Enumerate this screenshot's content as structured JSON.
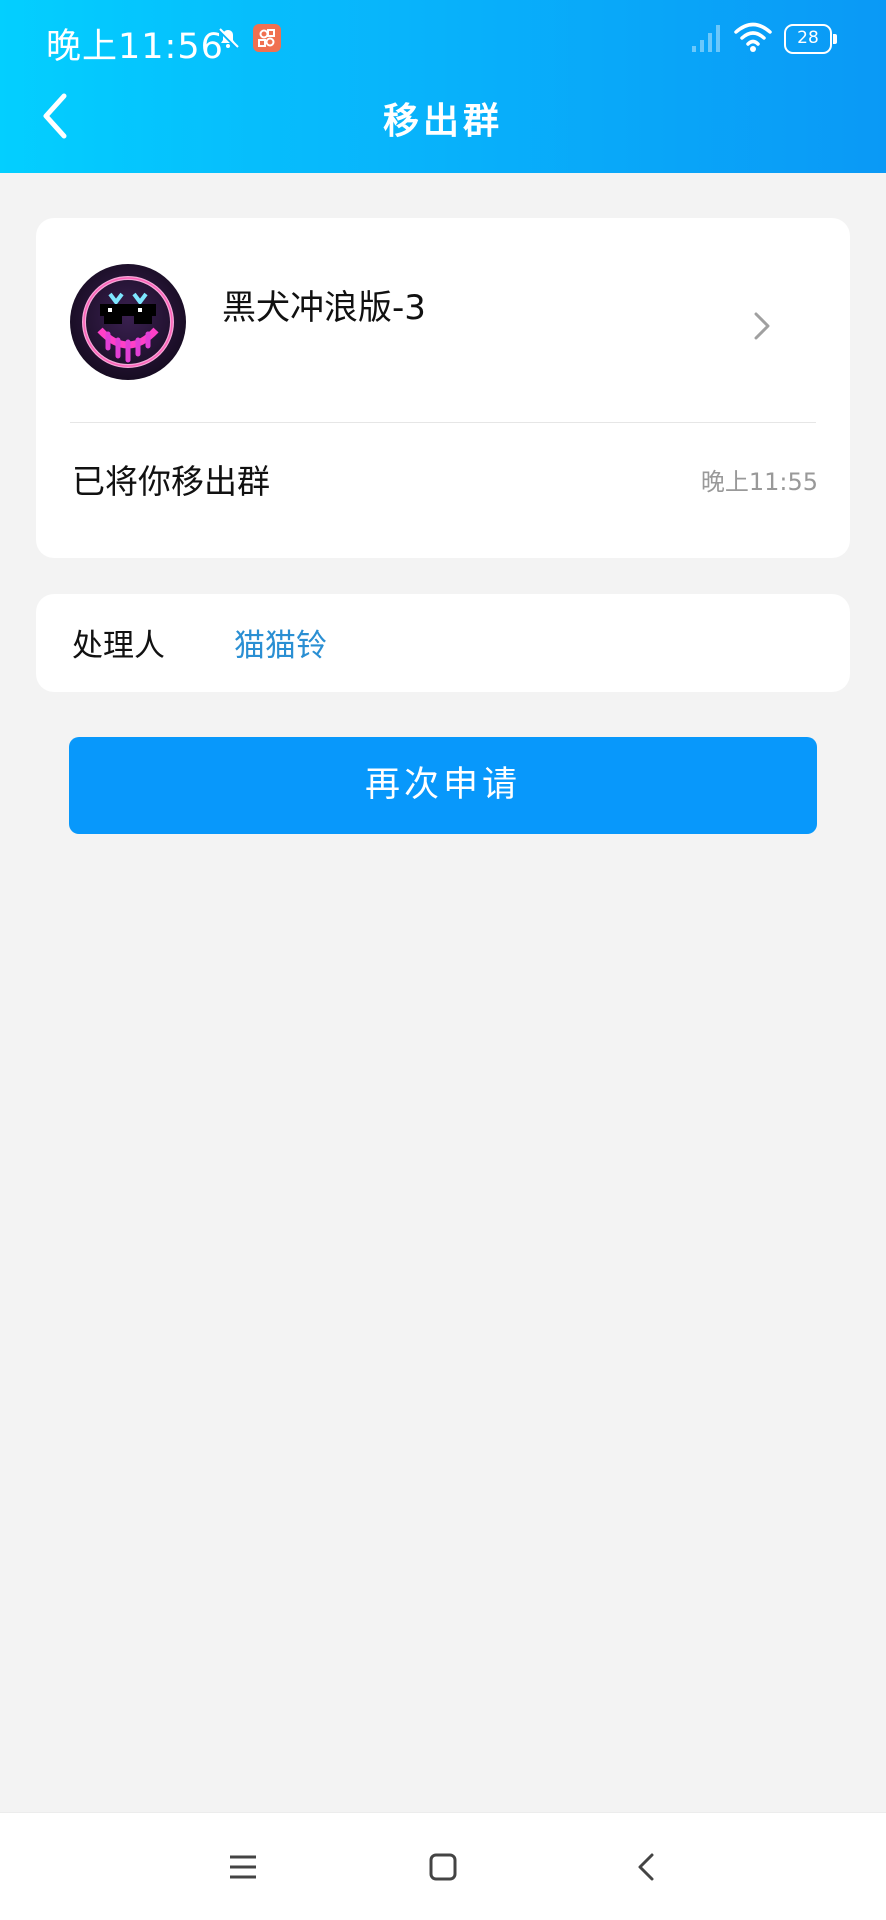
{
  "status_bar": {
    "time": "晚上11:56",
    "battery": "28",
    "icons": [
      "muted-bell-icon",
      "app-notification-icon",
      "signal-icon",
      "wifi-icon",
      "battery-icon"
    ]
  },
  "header": {
    "title": "移出群",
    "back_icon": "back-arrow-icon"
  },
  "group_card": {
    "group_name": "黑犬冲浪版-3",
    "notice": "已将你移出群",
    "notice_time": "晚上11:55"
  },
  "handler_card": {
    "label": "处理人",
    "name": "猫猫铃"
  },
  "actions": {
    "reapply_label": "再次申请"
  },
  "colors": {
    "header_gradient_start": "#03cfff",
    "header_gradient_end": "#0a99f6",
    "primary_button": "#0898fb",
    "link_text": "#2a8fd3",
    "background": "#f3f3f3"
  },
  "nav_bar": {
    "icons": [
      "menu-icon",
      "home-icon",
      "back-icon"
    ]
  }
}
